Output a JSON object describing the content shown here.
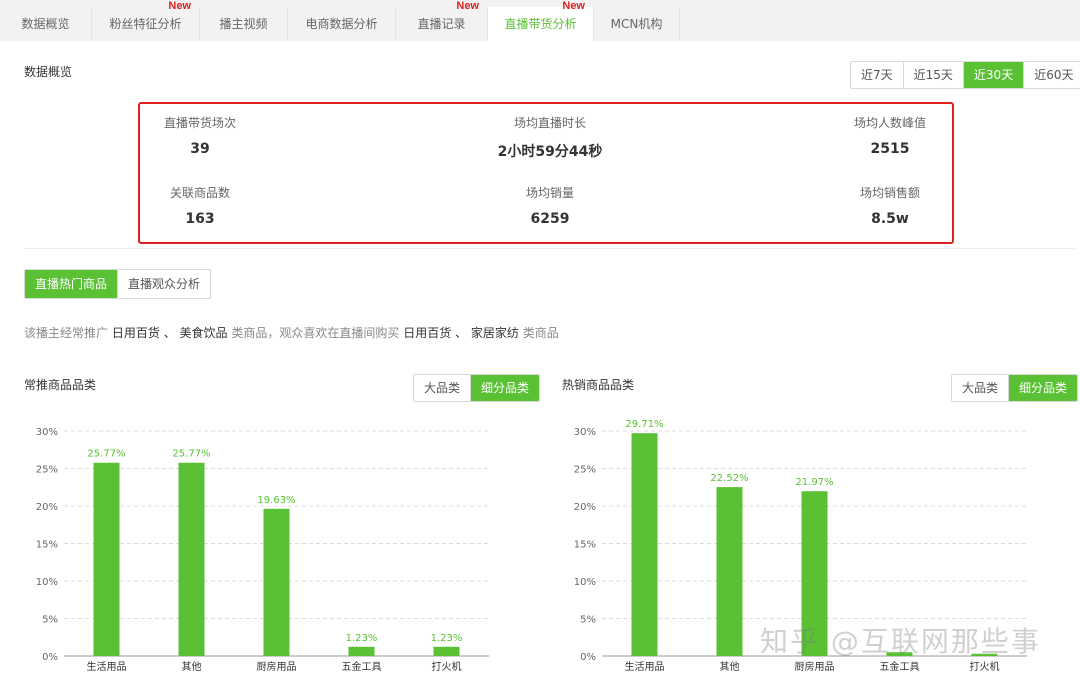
{
  "tabs": [
    {
      "label": "数据概览",
      "new": ""
    },
    {
      "label": "粉丝特征分析",
      "new": "New"
    },
    {
      "label": "播主视频",
      "new": ""
    },
    {
      "label": "电商数据分析",
      "new": ""
    },
    {
      "label": "直播记录",
      "new": "New"
    },
    {
      "label": "直播带货分析",
      "new": "New"
    },
    {
      "label": "MCN机构",
      "new": ""
    }
  ],
  "overview": {
    "title": "数据概览",
    "ranges": [
      "近7天",
      "近15天",
      "近30天",
      "近60天"
    ],
    "active_range": "近30天",
    "metrics": [
      {
        "label": "直播带货场次",
        "value": "39"
      },
      {
        "label": "场均直播时长",
        "value": "2小时59分44秒"
      },
      {
        "label": "场均人数峰值",
        "value": "2515"
      },
      {
        "label": "关联商品数",
        "value": "163"
      },
      {
        "label": "场均销量",
        "value": "6259"
      },
      {
        "label": "场均销售额",
        "value": "8.5w"
      }
    ]
  },
  "sub_tabs": [
    "直播热门商品",
    "直播观众分析"
  ],
  "summary": {
    "p1": "该播主经常推广",
    "c1": "日用百货",
    "s1": "、",
    "c2": "美食饮品",
    "p2": "类商品，观众喜欢在直播间购买",
    "c3": "日用百货",
    "s2": "、",
    "c4": "家居家纺",
    "p3": "类商品"
  },
  "category_toggle": [
    "大品类",
    "细分品类"
  ],
  "chart_data": [
    {
      "type": "bar",
      "title": "常推商品品类",
      "categories": [
        "生活用品",
        "其他",
        "厨房用品",
        "五金工具",
        "打火机"
      ],
      "values": [
        25.77,
        25.77,
        19.63,
        1.23,
        1.23
      ],
      "data_labels": [
        "25.77%",
        "25.77%",
        "19.63%",
        "1.23%",
        "1.23%"
      ],
      "ylim": [
        0,
        30
      ],
      "yticks": [
        "0%",
        "5%",
        "10%",
        "15%",
        "20%",
        "25%",
        "30%"
      ],
      "grid": true,
      "color": "#5ac135"
    },
    {
      "type": "bar",
      "title": "热销商品品类",
      "categories": [
        "生活用品",
        "其他",
        "厨房用品",
        "五金工具",
        "打火机"
      ],
      "values": [
        29.71,
        22.52,
        21.97,
        0.5,
        0.3
      ],
      "data_labels": [
        "29.71%",
        "22.52%",
        "21.97%",
        "",
        ""
      ],
      "ylim": [
        0,
        30
      ],
      "yticks": [
        "0%",
        "5%",
        "10%",
        "15%",
        "20%",
        "25%",
        "30%"
      ],
      "grid": true,
      "color": "#5ac135"
    }
  ],
  "watermark": "知乎 @互联网那些事",
  "colors": {
    "accent": "#5ac135",
    "highlight_border": "#e02020",
    "new_badge": "#e02020"
  }
}
